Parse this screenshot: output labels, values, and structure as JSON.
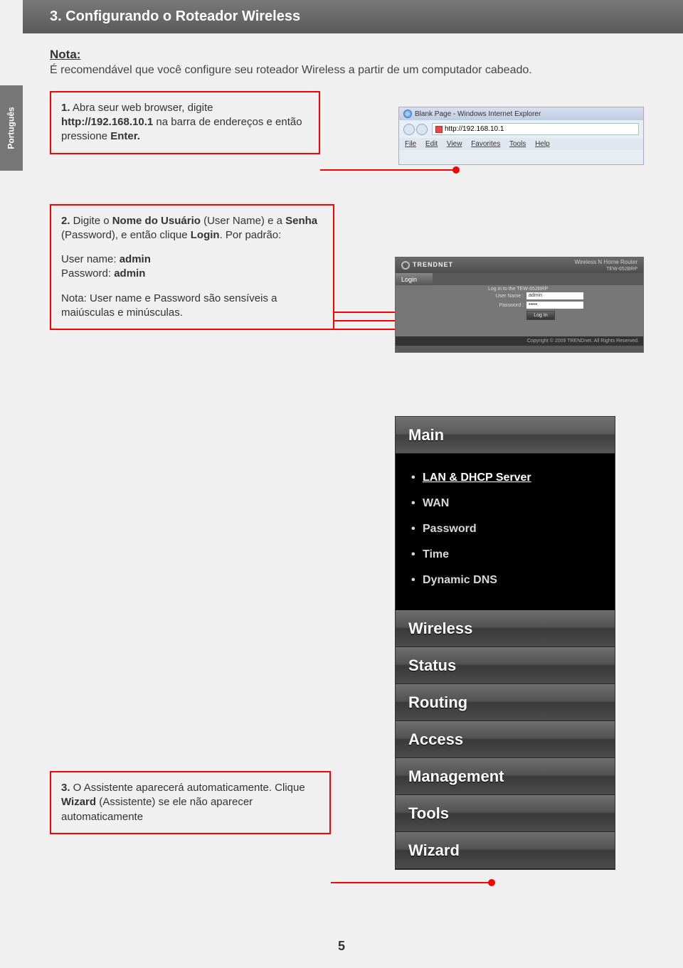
{
  "header": {
    "title": "3. Configurando o Roteador Wireless"
  },
  "side_tab": "Português",
  "intro": {
    "nota": "Nota:",
    "text": "É recomendável que você configure seu roteador Wireless a partir de um computador cabeado."
  },
  "step1": {
    "num": "1.",
    "text_a": " Abra seur web browser, digite",
    "url": "http://192.168.10.1",
    "text_b": " na barra de endereços e então pressione ",
    "enter": "Enter."
  },
  "step2": {
    "num": "2.",
    "text_a": " Digite o ",
    "bold_a": "Nome do Usuário",
    "text_b": " (User Name) e a ",
    "bold_b": "Senha",
    "text_c": " (Password), e então clique ",
    "bold_c": "Login",
    "text_d": ". Por padrão:",
    "user_label": "User name: ",
    "user_val": "admin",
    "pass_label": "Password: ",
    "pass_val": "admin",
    "note": "Nota: User name e Password são sensíveis a maiúsculas e minúsculas."
  },
  "step3": {
    "num": "3.",
    "text_a": " O Assistente aparecerá automaticamente. Clique ",
    "bold_a": "Wizard",
    "text_b": " (Assistente) se ele não aparecer automaticamente"
  },
  "browser": {
    "title": "Blank Page - Windows Internet Explorer",
    "address": "http://192.168.10.1",
    "menu": {
      "file": "File",
      "edit": "Edit",
      "view": "View",
      "favorites": "Favorites",
      "tools": "Tools",
      "help": "Help"
    }
  },
  "login": {
    "brand": "TRENDNET",
    "subtitle": "Wireless N Home Router",
    "model": "TEW-652BRP",
    "tab": "Login",
    "heading": "Log in to the TEW-652BRP",
    "user_label": "User Name :",
    "user_val": "admin",
    "pass_label": "Password :",
    "pass_val": "•••••",
    "btn": "Log In",
    "copyright": "Copyright © 2009 TRENDnet. All Rights Reserved."
  },
  "menu": {
    "main": "Main",
    "items": [
      "LAN & DHCP Server",
      "WAN",
      "Password",
      "Time",
      "Dynamic DNS"
    ],
    "sections": [
      "Wireless",
      "Status",
      "Routing",
      "Access",
      "Management",
      "Tools",
      "Wizard"
    ]
  },
  "page_num": "5"
}
